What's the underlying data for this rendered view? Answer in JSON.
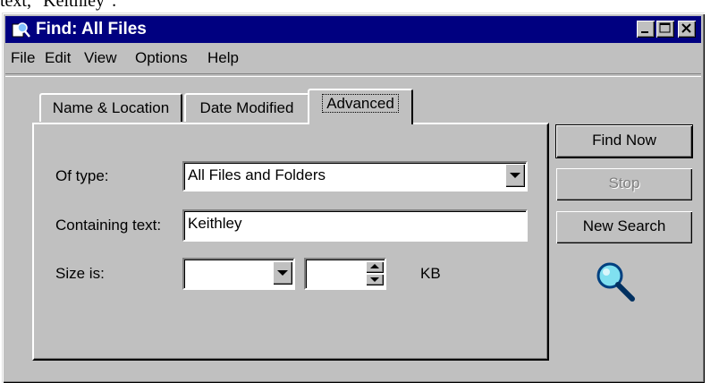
{
  "background_text": "text, \"Keithley\".",
  "window": {
    "title": "Find: All Files",
    "titlebar_color": "#000080"
  },
  "menu": {
    "items": [
      {
        "label": "File"
      },
      {
        "label": "Edit"
      },
      {
        "label": "View"
      },
      {
        "label": "Options"
      },
      {
        "label": "Help"
      }
    ]
  },
  "tabs": [
    {
      "label": "Name & Location"
    },
    {
      "label": "Date Modified"
    },
    {
      "label": "Advanced",
      "active": true
    }
  ],
  "advanced": {
    "of_type_label": "Of type:",
    "of_type_value": "All Files and Folders",
    "containing_text_label": "Containing text:",
    "containing_text_value": "Keithley",
    "size_label": "Size is:",
    "size_mode_value": "",
    "size_amount_value": "",
    "size_unit": "KB"
  },
  "buttons": {
    "find_now": "Find Now",
    "stop": "Stop",
    "new_search": "New Search"
  },
  "icons": {
    "title_icon": "find-files-icon",
    "search_animation": "magnifying-glass-icon"
  }
}
